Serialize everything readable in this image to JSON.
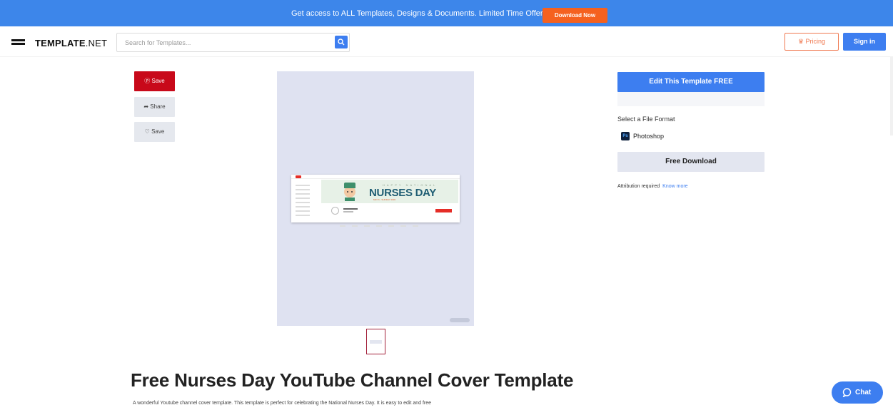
{
  "promo": {
    "text": "Get access to ALL Templates, Designs & Documents. Limited Time Offer",
    "button": "Download Now"
  },
  "header": {
    "logo_bold": "TEMPLATE",
    "logo_rest": ".NET",
    "search_placeholder": "Search for Templates...",
    "pricing": "Pricing",
    "signin": "Sign in"
  },
  "actions": {
    "save": "Save",
    "share": "Share",
    "save_alt": "Save"
  },
  "preview": {
    "banner_small": "HAPPY NATIONAL",
    "banner_title": "NURSES DAY",
    "banner_sub": "MAY 6 - SUNDAY 2030"
  },
  "panel": {
    "edit_button": "Edit This Template FREE",
    "format_label": "Select a File Format",
    "format_option": "Photoshop",
    "format_icon": "Ps",
    "download_button": "Free Download",
    "attribution": "Attribution required",
    "know_more": "Know more"
  },
  "content": {
    "title": "Free Nurses Day YouTube Channel Cover Template",
    "description": "A wonderful Youtube channel cover template. This template is perfect for celebrating the National Nurses Day. It is easy to edit and free"
  },
  "chat": {
    "label": "Chat"
  },
  "colors": {
    "brand_blue": "#3d7ef0",
    "promo_orange": "#f5611f",
    "pinterest_red": "#c8091a"
  }
}
